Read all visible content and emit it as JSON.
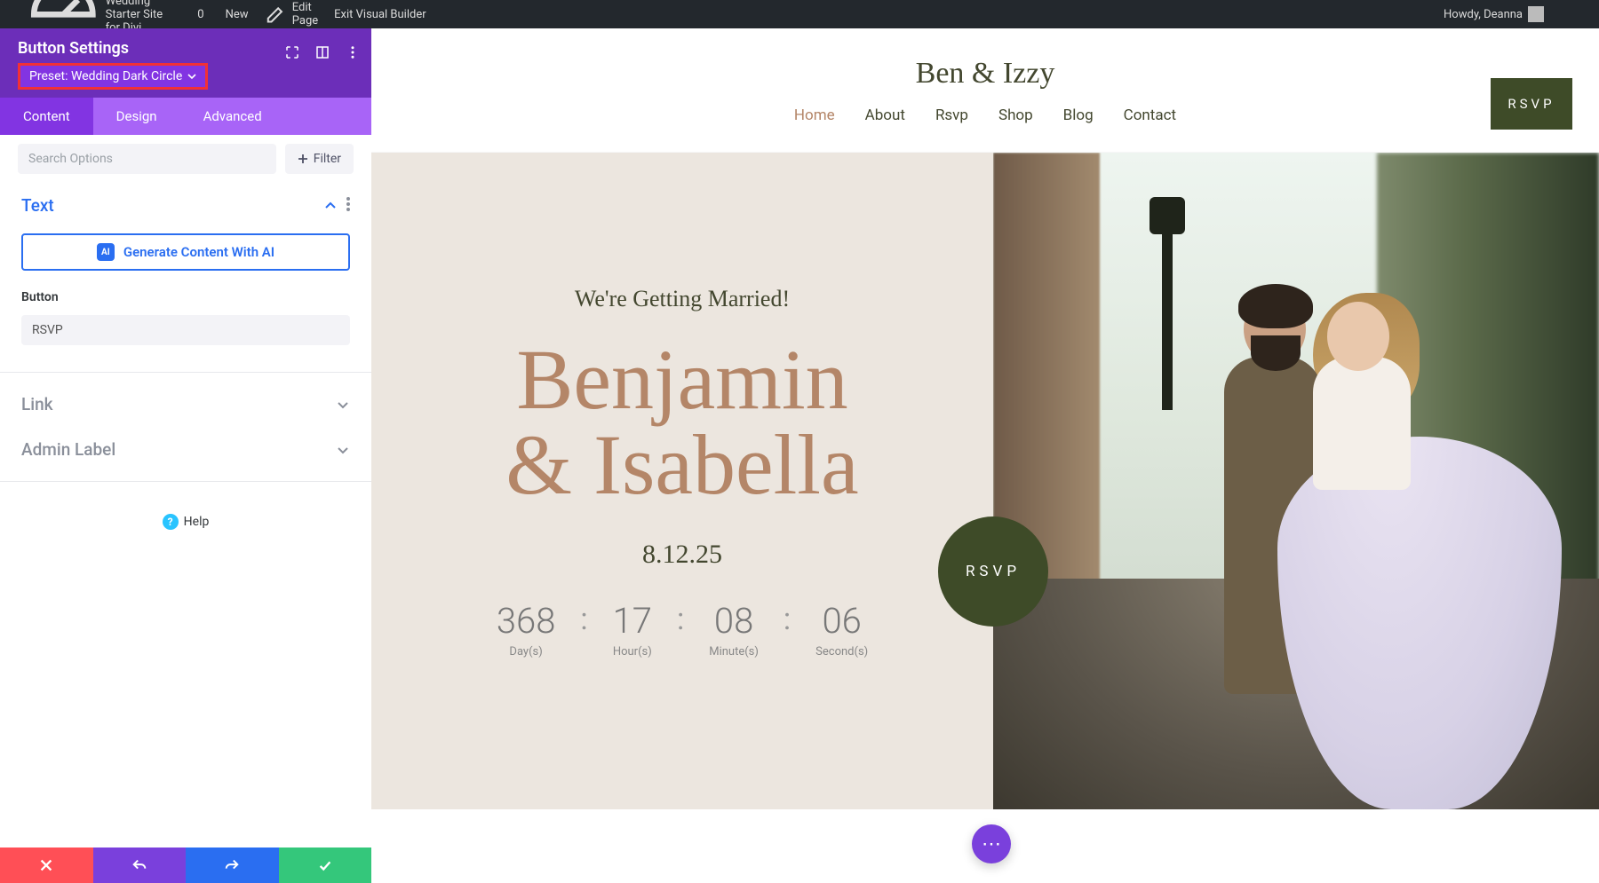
{
  "adminbar": {
    "site_title": "Wedding Starter Site for Divi",
    "comments": "0",
    "new": "New",
    "edit": "Edit Page",
    "exit": "Exit Visual Builder",
    "howdy": "Howdy, Deanna"
  },
  "sidebar": {
    "heading": "Button Settings",
    "preset_label": "Preset: Wedding Dark Circle",
    "tabs": {
      "content": "Content",
      "design": "Design",
      "advanced": "Advanced"
    },
    "search_placeholder": "Search Options",
    "filter_label": "Filter",
    "sections": {
      "text": "Text",
      "link": "Link",
      "admin_label": "Admin Label"
    },
    "ai_button": "Generate Content With AI",
    "ai_badge": "AI",
    "button_field_label": "Button",
    "button_field_value": "RSVP",
    "help": "Help"
  },
  "site": {
    "logo": "Ben & Izzy",
    "nav": [
      "Home",
      "About",
      "Rsvp",
      "Shop",
      "Blog",
      "Contact"
    ],
    "nav_active_index": 0,
    "rsvp_label": "RSVP",
    "hero": {
      "subtitle": "We're Getting Married!",
      "line1": "Benjamin",
      "line2": "& Isabella",
      "date": "8.12.25",
      "countdown": {
        "days": "368",
        "days_lbl": "Day(s)",
        "hours": "17",
        "hours_lbl": "Hour(s)",
        "minutes": "08",
        "minutes_lbl": "Minute(s)",
        "seconds": "06",
        "seconds_lbl": "Second(s)",
        "sep": ":"
      }
    }
  },
  "fab": "⋯"
}
